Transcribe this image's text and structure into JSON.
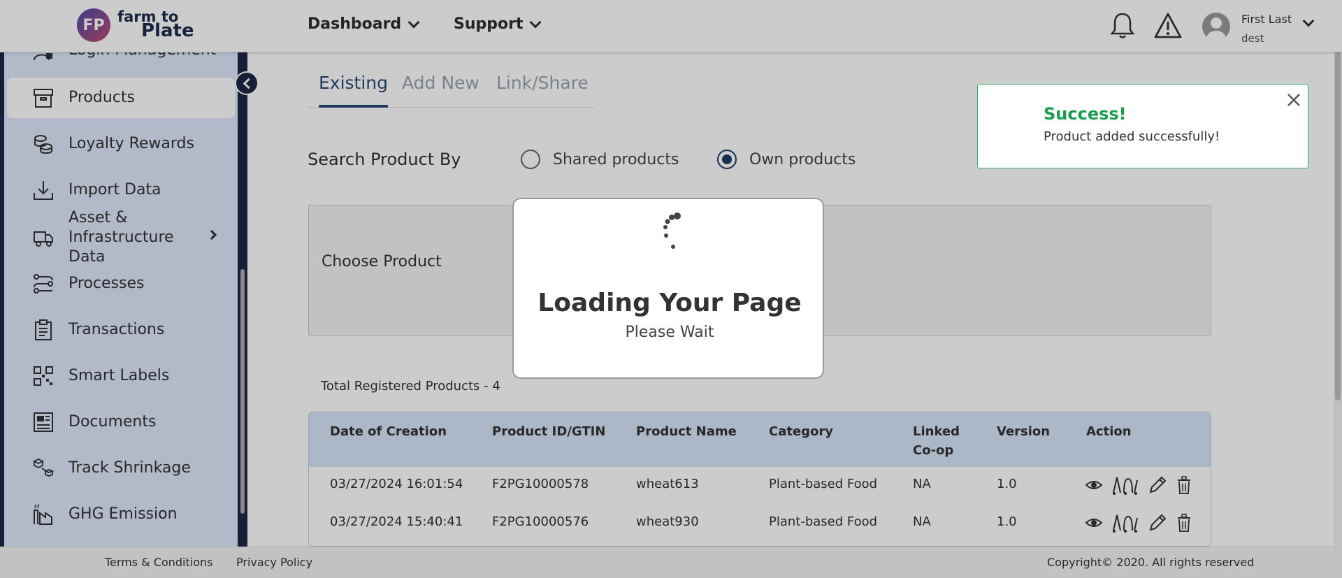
{
  "brand": {
    "logo_initials": "FP",
    "name_line1": "farm to",
    "name_line2": "Plate"
  },
  "header": {
    "nav": [
      {
        "label": "Dashboard"
      },
      {
        "label": "Support"
      }
    ],
    "user": {
      "name": "First Last",
      "subtitle": "dest"
    }
  },
  "sidebar": {
    "items": [
      {
        "label": "Login Management",
        "icon": "login-management-icon"
      },
      {
        "label": "Products",
        "icon": "box-icon",
        "active": true
      },
      {
        "label": "Loyalty Rewards",
        "icon": "coins-icon"
      },
      {
        "label": "Import Data",
        "icon": "download-icon"
      },
      {
        "label": "Asset & Infrastructure Data",
        "icon": "truck-icon",
        "has_submenu": true
      },
      {
        "label": "Processes",
        "icon": "process-icon"
      },
      {
        "label": "Transactions",
        "icon": "clipboard-icon"
      },
      {
        "label": "Smart Labels",
        "icon": "qr-icon"
      },
      {
        "label": "Documents",
        "icon": "document-icon"
      },
      {
        "label": "Track Shrinkage",
        "icon": "shrinkage-icon"
      },
      {
        "label": "GHG Emission",
        "icon": "factory-icon"
      }
    ]
  },
  "tabs": [
    {
      "label": "Existing",
      "active": true
    },
    {
      "label": "Add New"
    },
    {
      "label": "Link/Share"
    }
  ],
  "search": {
    "label": "Search Product By",
    "options": [
      {
        "label": "Shared products",
        "selected": false
      },
      {
        "label": "Own products",
        "selected": true
      }
    ],
    "choose_label": "Choose Product"
  },
  "total_label": "Total Registered Products - 4",
  "table": {
    "headers": [
      "Date of Creation",
      "Product ID/GTIN",
      "Product Name",
      "Category",
      "Linked Co-op",
      "Version",
      "Action"
    ],
    "rows": [
      {
        "date": "03/27/2024 16:01:54",
        "id": "F2PG10000578",
        "name": "wheat613",
        "category": "Plant-based Food",
        "coop": "NA",
        "version": "1.0"
      },
      {
        "date": "03/27/2024 15:40:41",
        "id": "F2PG10000576",
        "name": "wheat930",
        "category": "Plant-based Food",
        "coop": "NA",
        "version": "1.0"
      }
    ]
  },
  "footer": {
    "terms": "Terms & Conditions",
    "privacy": "Privacy Policy",
    "copyright": "Copyright© 2020. All rights reserved"
  },
  "loader": {
    "title": "Loading Your Page",
    "subtitle": "Please Wait"
  },
  "toast": {
    "title": "Success!",
    "message": "Product added successfully!"
  },
  "colors": {
    "accent": "#2b4a74",
    "sidebar_bg": "#dfe9fc",
    "sidebar_edge": "#1d2746",
    "success": "#1a9e4e",
    "table_header": "#d8e5fb"
  }
}
